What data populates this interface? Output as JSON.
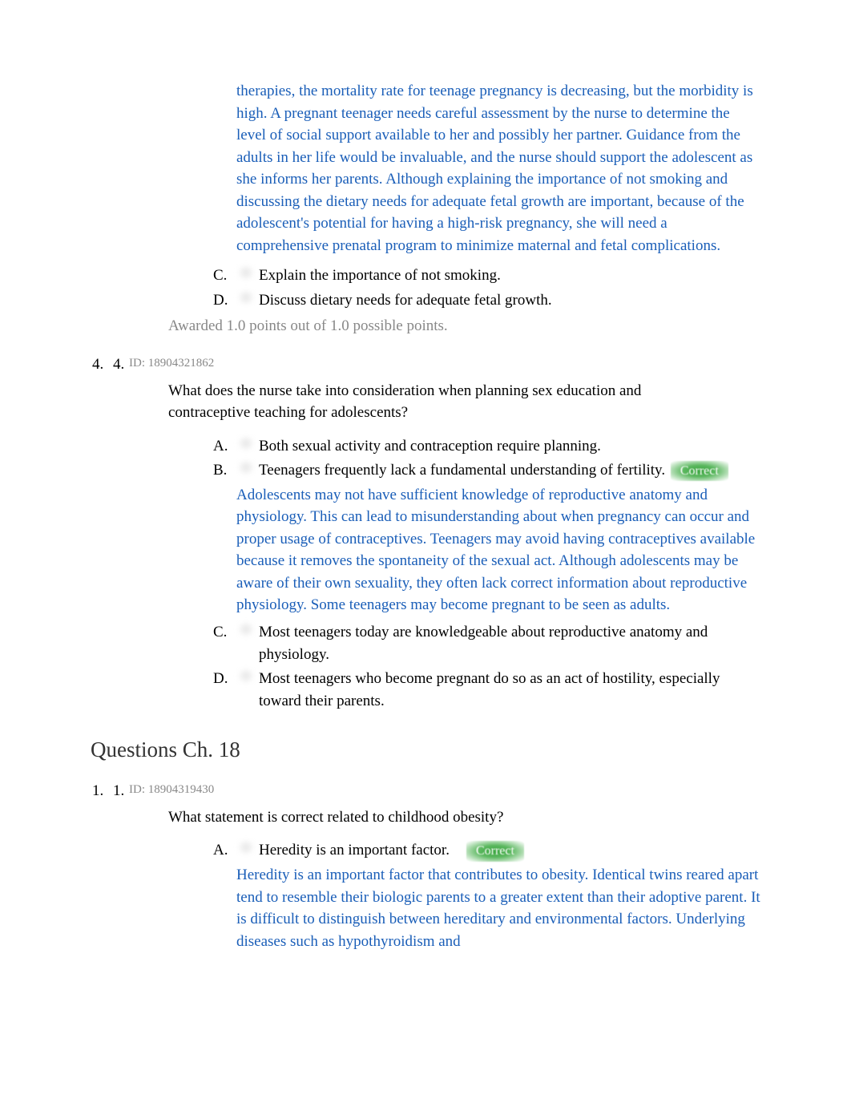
{
  "q3": {
    "explanation_cont": "therapies, the mortality rate for teenage pregnancy is decreasing, but the morbidity is high. A pregnant teenager needs careful assessment by the nurse to determine the level of social support available to her and possibly her partner. Guidance from the adults in her life would be invaluable, and the nurse should support the adolescent as she informs her parents. Although explaining the importance of not smoking and discussing the dietary needs for adequate fetal growth are important, because of the adolescent's potential for having a high-risk pregnancy, she will need a comprehensive prenatal program to minimize maternal and fetal complications.",
    "options": {
      "C": {
        "letter": "C.",
        "text": "Explain the importance of not smoking."
      },
      "D": {
        "letter": "D.",
        "text": "Discuss dietary needs for adequate fetal growth."
      }
    },
    "points": "Awarded 1.0 points out of 1.0 possible points."
  },
  "q4": {
    "num1": "4.",
    "num2": "4.",
    "id": "ID: 18904321862",
    "stem": "What does the nurse take into consideration when planning sex education and contraceptive teaching for adolescents?",
    "options": {
      "A": {
        "letter": "A.",
        "text": "Both sexual activity and contraception require planning."
      },
      "B": {
        "letter": "B.",
        "text": "Teenagers frequently lack a fundamental understanding of fertility.",
        "badge": "Correct"
      },
      "C": {
        "letter": "C.",
        "text": "Most teenagers today are knowledgeable about reproductive anatomy and physiology."
      },
      "D": {
        "letter": "D.",
        "text": "Most teenagers who become pregnant do so as an act of hostility, especially toward their parents."
      }
    },
    "explanation": "Adolescents may not have sufficient knowledge of reproductive anatomy and physiology. This can lead to misunderstanding about when pregnancy can occur and proper usage of contraceptives. Teenagers may avoid having contraceptives available because it removes the spontaneity of the sexual act. Although adolescents may be aware of their own sexuality, they often lack correct information about reproductive physiology. Some teenagers may become pregnant to be seen as adults."
  },
  "chapter": {
    "heading": "Questions Ch. 18"
  },
  "q1": {
    "num1": "1.",
    "num2": "1.",
    "id": "ID: 18904319430",
    "stem": "What statement is correct related to childhood obesity?",
    "options": {
      "A": {
        "letter": "A.",
        "text": "Heredity is an important factor.",
        "badge": "Correct"
      }
    },
    "explanation": "Heredity is an important factor that contributes to obesity. Identical twins reared apart tend to resemble their biologic parents to a greater extent than their adoptive parent. It is difficult to distinguish between hereditary and environmental factors. Underlying diseases such as hypothyroidism and"
  }
}
